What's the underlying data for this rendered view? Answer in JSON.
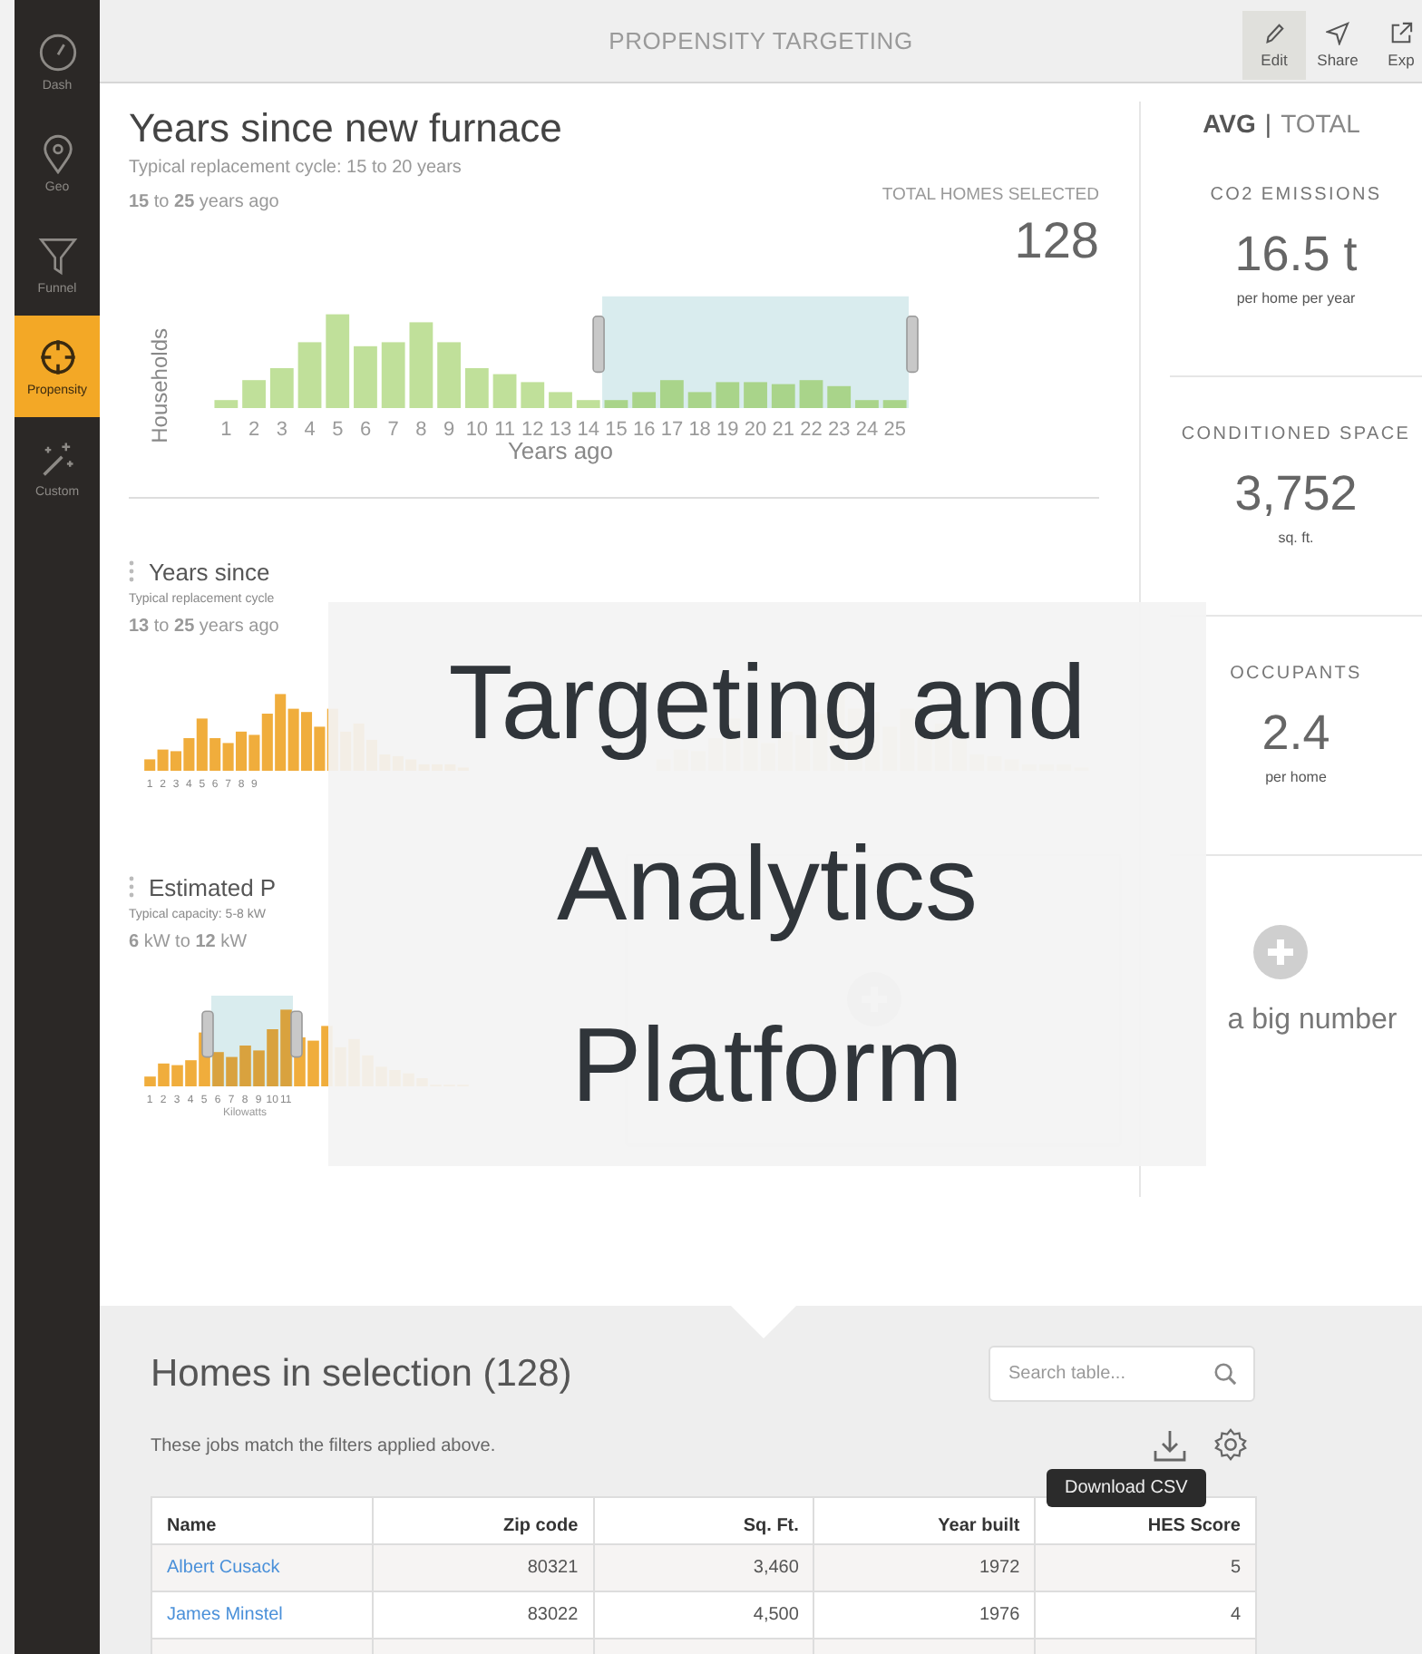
{
  "sidebar": {
    "items": [
      {
        "label": "Dash",
        "kind": "gauge",
        "selected": false
      },
      {
        "label": "Geo",
        "kind": "pin",
        "selected": false
      },
      {
        "label": "Funnel",
        "kind": "funnel",
        "selected": false
      },
      {
        "label": "Propensity",
        "kind": "target",
        "selected": true
      },
      {
        "label": "Custom",
        "kind": "wand",
        "selected": false
      }
    ]
  },
  "header": {
    "title": "PROPENSITY TARGETING",
    "actions": [
      {
        "label": "Edit",
        "kind": "pencil",
        "selected": true
      },
      {
        "label": "Share",
        "kind": "send",
        "selected": false
      },
      {
        "label": "Exp",
        "kind": "export",
        "selected": false
      }
    ]
  },
  "main_filter": {
    "title": "Years since new furnace",
    "subtitle": "Typical replacement cycle: 15 to 20 years",
    "range": "**15** to **25** years ago",
    "ylabel": "Households",
    "xlabel": "Years ago",
    "ticks": [
      {
        "label": "1",
        "selected": false
      },
      {
        "label": "2",
        "selected": false
      },
      {
        "label": "3",
        "selected": false
      },
      {
        "label": "4",
        "selected": false
      },
      {
        "label": "5",
        "selected": false
      },
      {
        "label": "6",
        "selected": false
      },
      {
        "label": "7",
        "selected": false
      },
      {
        "label": "8",
        "selected": false
      },
      {
        "label": "9",
        "selected": false
      },
      {
        "label": "10",
        "selected": false
      },
      {
        "label": "11",
        "selected": false
      },
      {
        "label": "12",
        "selected": false
      },
      {
        "label": "13",
        "selected": false
      },
      {
        "label": "14",
        "selected": false
      },
      {
        "label": "15",
        "selected": true
      },
      {
        "label": "16",
        "selected": true
      },
      {
        "label": "17",
        "selected": true
      },
      {
        "label": "18",
        "selected": true
      },
      {
        "label": "19",
        "selected": true
      },
      {
        "label": "20",
        "selected": true
      },
      {
        "label": "21",
        "selected": true
      },
      {
        "label": "22",
        "selected": true
      },
      {
        "label": "23",
        "selected": true
      },
      {
        "label": "24",
        "selected": true
      },
      {
        "label": "25",
        "selected": true
      }
    ]
  },
  "total": {
    "label": "TOTAL HOMES SELECTED",
    "value": "128"
  },
  "small_filters": [
    {
      "title": "Years since",
      "subtitle": "Typical replacement cycle",
      "range": "**13** to **25** years ago",
      "bars": [
        {
          "label": "1",
          "selected": false
        },
        {
          "label": "2",
          "selected": false
        },
        {
          "label": "3",
          "selected": false
        },
        {
          "label": "4",
          "selected": false
        },
        {
          "label": "5",
          "selected": false
        },
        {
          "label": "6",
          "selected": false
        },
        {
          "label": "7",
          "selected": false
        },
        {
          "label": "8",
          "selected": false
        },
        {
          "label": "9",
          "selected": false
        }
      ]
    },
    {
      "kind": "covered"
    },
    {
      "title": "Estimated P",
      "subtitle": "Typical capacity: 5-8 kW",
      "range": "**6** kW to **12** kW",
      "xlabel": "Kilowatts",
      "bars": [
        {
          "label": "1",
          "selected": false
        },
        {
          "label": "2",
          "selected": false
        },
        {
          "label": "3",
          "selected": false
        },
        {
          "label": "4",
          "selected": false
        },
        {
          "label": "5",
          "selected": false
        },
        {
          "label": "6",
          "selected": true
        },
        {
          "label": "7",
          "selected": true
        },
        {
          "label": "8",
          "selected": true
        },
        {
          "label": "9",
          "selected": true
        },
        {
          "label": "10",
          "selected": true
        },
        {
          "label": "11",
          "selected": true
        }
      ]
    }
  ],
  "summary": {
    "modes": [
      {
        "label": "AVG",
        "selected": true
      },
      {
        "label": "TOTAL",
        "selected": false
      }
    ],
    "separator": "|",
    "stats": [
      {
        "label": "CO2 EMISSIONS",
        "value": "16.5 t",
        "unit": "per home per year"
      },
      {
        "label": "CONDITIONED SPACE",
        "value": "3,752",
        "unit": "sq. ft."
      },
      {
        "label": "OCCUPANTS",
        "value": "2.4",
        "unit": "per home"
      }
    ],
    "add": "a big number"
  },
  "overlay_title": [
    "Targeting and",
    "Analytics",
    "Platform"
  ],
  "homes": {
    "title": "Homes in selection (128)",
    "search_placeholder": "Search table...",
    "note": "These jobs match the filters applied above.",
    "tooltip": "Download CSV",
    "columns": [
      "Name",
      "Zip code",
      "Sq. Ft.",
      "Year built",
      "HES Score"
    ],
    "rows": [
      [
        "Albert Cusack",
        "80321",
        "3,460",
        "1972",
        "5"
      ],
      [
        "James Minstel",
        "83022",
        "4,500",
        "1976",
        "4"
      ],
      []
    ]
  }
}
